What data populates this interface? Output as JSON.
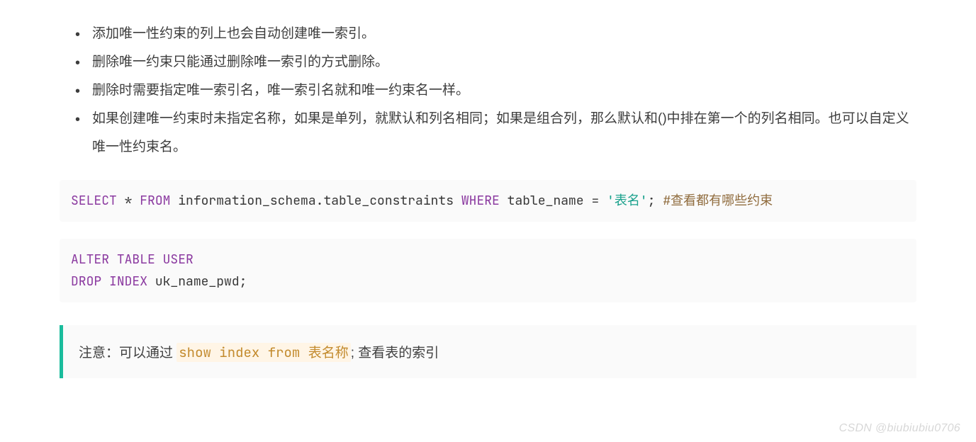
{
  "bullets": [
    "添加唯一性约束的列上也会自动创建唯一索引。",
    "删除唯一约束只能通过删除唯一索引的方式删除。",
    "删除时需要指定唯一索引名，唯一索引名就和唯一约束名一样。",
    "如果创建唯一约束时未指定名称，如果是单列，就默认和列名相同；如果是组合列，那么默认和()中排在第一个的列名相同。也可以自定义唯一性约束名。"
  ],
  "code1": {
    "kw_select": "SELECT",
    "star": " * ",
    "kw_from": "FROM",
    "schema": " information_schema",
    "dot": ".",
    "table": "table_constraints",
    "kw_where": " WHERE",
    "col": " table_name ",
    "eq": "=",
    "sp": " ",
    "str": "'表名'",
    "semi": "; ",
    "comment": "#查看都有哪些约束"
  },
  "code2": {
    "kw_alter": "ALTER",
    "sp1": " ",
    "kw_table": "TABLE",
    "sp2": " ",
    "kw_user": "USER",
    "nl": "\n",
    "kw_drop": "DROP",
    "sp3": " ",
    "kw_index": "INDEX",
    "ident": " uk_name_pwd;"
  },
  "note": {
    "prefix": "注意：可以通过 ",
    "kw_show": "show",
    "sp1": " ",
    "kw_index": "index",
    "sp2": " ",
    "kw_from": "from",
    "sp3": " ",
    "tbl": "表名称",
    "semi": ";",
    "suffix": " 查看表的索引"
  },
  "watermark": "CSDN @biubiubiu0706"
}
